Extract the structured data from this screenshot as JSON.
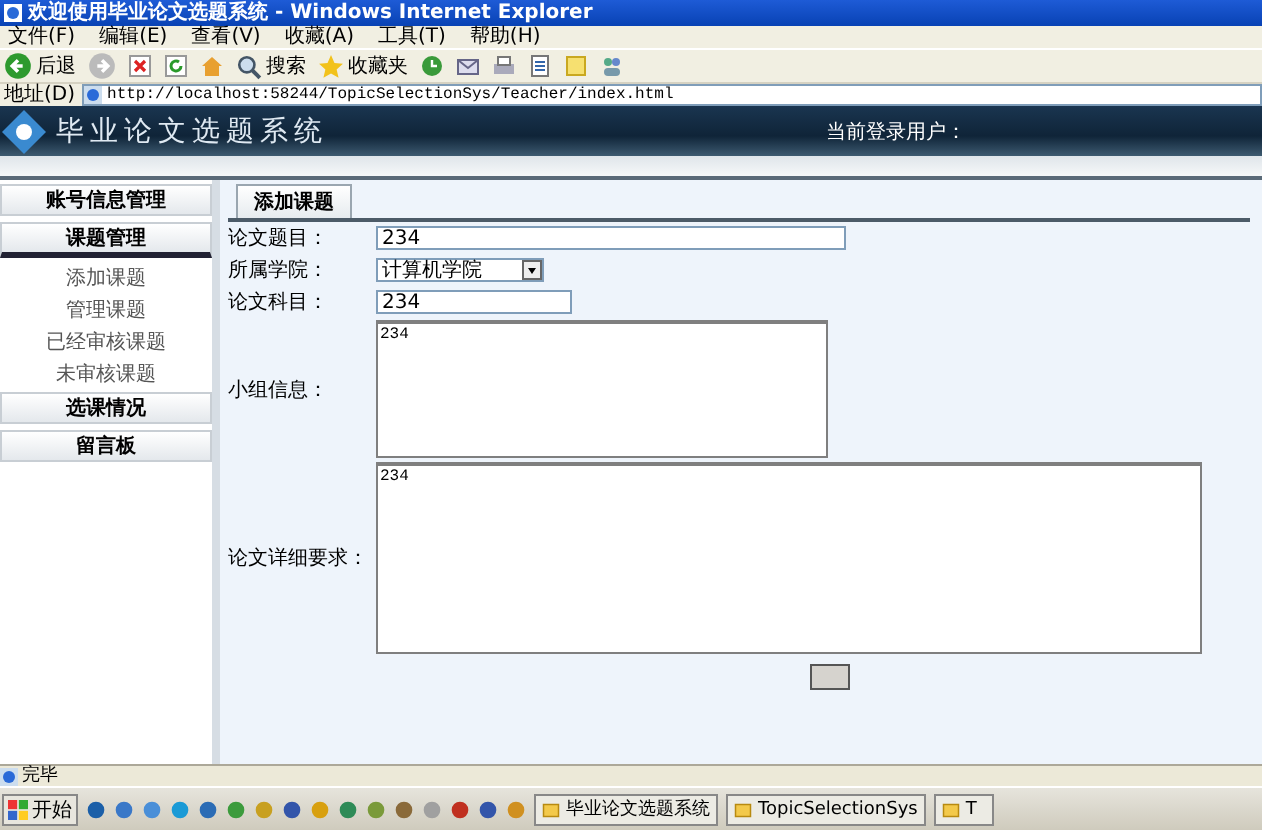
{
  "window": {
    "title": "欢迎使用毕业论文选题系统 - Windows Internet Explorer"
  },
  "menu": [
    "文件(F)",
    "编辑(E)",
    "查看(V)",
    "收藏(A)",
    "工具(T)",
    "帮助(H)"
  ],
  "toolbar": {
    "back": "后退",
    "search": "搜索",
    "favorites": "收藏夹"
  },
  "address": {
    "label": "地址(D)",
    "url": "http://localhost:58244/TopicSelectionSys/Teacher/index.html"
  },
  "header": {
    "title": "毕业论文选题系统",
    "user_label": "当前登录用户："
  },
  "sidebar": {
    "sections": [
      {
        "title": "账号信息管理",
        "expanded": false
      },
      {
        "title": "课题管理",
        "expanded": true,
        "children": [
          {
            "label": "添加课题"
          },
          {
            "label": "管理课题"
          },
          {
            "label": "已经审核课题"
          },
          {
            "label": "未审核课题"
          }
        ]
      },
      {
        "title": "选课情况",
        "expanded": false
      },
      {
        "title": "留言板",
        "expanded": false
      }
    ]
  },
  "tabs": [
    {
      "label": "添加课题",
      "selected": true
    }
  ],
  "form": {
    "fields": [
      {
        "kind": "text",
        "label": "论文题目：",
        "value": "234"
      },
      {
        "kind": "select",
        "label": "所属学院：",
        "value": "计算机学院"
      },
      {
        "kind": "text",
        "label": "论文科目：",
        "value": "234"
      },
      {
        "kind": "textarea",
        "label": "小组信息：",
        "value": "234"
      },
      {
        "kind": "textarea",
        "label": "论文详细要求：",
        "value": "234"
      }
    ]
  },
  "status_bar": {
    "text": "完毕"
  },
  "taskbar": {
    "start": "开始",
    "tasks": [
      "毕业论文选题系统",
      "TopicSelectionSys",
      "T"
    ]
  }
}
